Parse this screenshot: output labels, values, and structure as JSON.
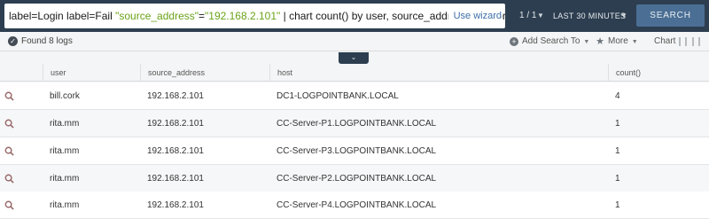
{
  "query": {
    "part1": "label=Login label=Fail ",
    "part2": "\"source_address\"",
    "part3": "=",
    "part4": "\"192.168.2.101\"",
    "part5": " | chart count() by user, source_address, host ord",
    "use_wizard": "Use wizard"
  },
  "pager": "1 / 1",
  "time_range": "LAST 30 MINUTES",
  "search_button": "SEARCH",
  "status": {
    "found": "Found 8 logs",
    "add_search": "Add Search To",
    "more": "More",
    "chart": "Chart"
  },
  "columns": [
    "user",
    "source_address",
    "host",
    "count()"
  ],
  "rows": [
    {
      "user": "bill.cork",
      "source_address": "192.168.2.101",
      "host": "DC1-LOGPOINTBANK.LOCAL",
      "count": "4"
    },
    {
      "user": "rita.mm",
      "source_address": "192.168.2.101",
      "host": "CC-Server-P1.LOGPOINTBANK.LOCAL",
      "count": "1"
    },
    {
      "user": "rita.mm",
      "source_address": "192.168.2.101",
      "host": "CC-Server-P3.LOGPOINTBANK.LOCAL",
      "count": "1"
    },
    {
      "user": "rita.mm",
      "source_address": "192.168.2.101",
      "host": "CC-Server-P2.LOGPOINTBANK.LOCAL",
      "count": "1"
    },
    {
      "user": "rita.mm",
      "source_address": "192.168.2.101",
      "host": "CC-Server-P4.LOGPOINTBANK.LOCAL",
      "count": "1"
    }
  ],
  "colors": {
    "topbar": "#2d3e50",
    "search_button": "#4b6f94",
    "string_literal": "#6aa31a",
    "wizard_link": "#3d6fa8",
    "magnifier": "#9a6a6a"
  },
  "icons": [
    "check-circle-icon",
    "plus-circle-icon",
    "star-icon",
    "chevron-down-icon",
    "magnifier-icon",
    "list-view-icon",
    "grid-view-icon"
  ]
}
